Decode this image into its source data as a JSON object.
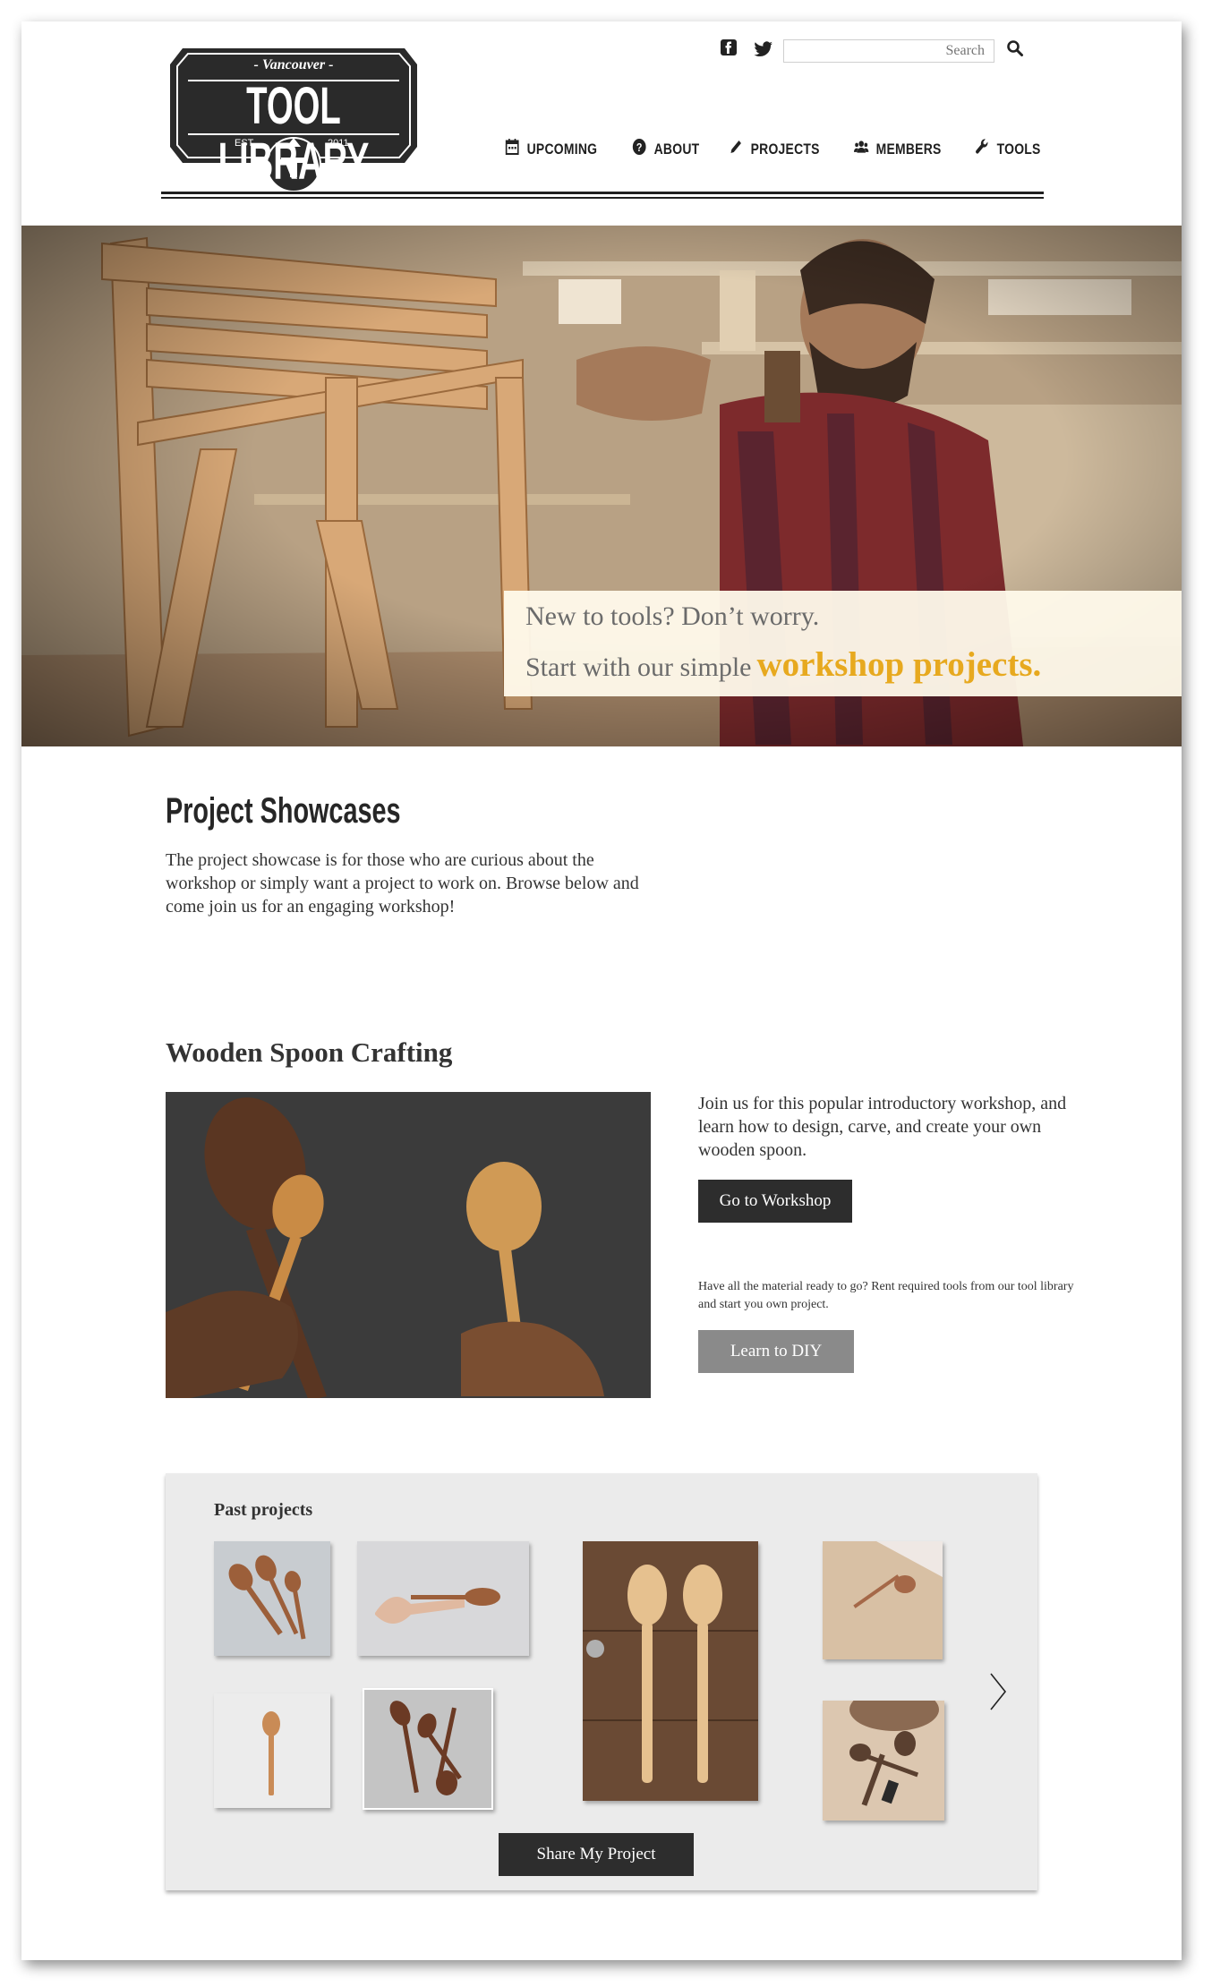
{
  "header": {
    "logo": {
      "top": "- Vancouver -",
      "main": "TOOL LIBRARY",
      "est": "EST.",
      "year": "2011"
    },
    "search_placeholder": "Search",
    "nav": [
      {
        "label": "UPCOMING",
        "icon": "calendar-icon"
      },
      {
        "label": "ABOUT",
        "icon": "question-circle-icon"
      },
      {
        "label": "PROJECTS",
        "icon": "pencil-icon"
      },
      {
        "label": "MEMBERS",
        "icon": "users-icon"
      },
      {
        "label": "TOOLS",
        "icon": "wrench-icon"
      }
    ],
    "social": [
      "facebook-icon",
      "twitter-icon"
    ]
  },
  "hero": {
    "line1": "New to tools? Don’t worry.",
    "line2": "Start with our simple",
    "highlight": "workshop projects.",
    "highlight_color": "#e7a91f"
  },
  "showcase": {
    "title": "Project Showcases",
    "text": "The project showcase is for those who are curious about the workshop or simply want a project to work on. Browse below and come join us for an engaging workshop!"
  },
  "workshop": {
    "title": "Wooden Spoon Crafting",
    "text": "Join us for this popular introductory workshop, and learn how to design, carve, and create your own wooden spoon.",
    "button": "Go to Workshop",
    "diy_text": "Have all the material ready to go? Rent required tools from our tool library and start you own project.",
    "diy_button": "Learn to DIY"
  },
  "past_projects": {
    "title": "Past projects",
    "share_button": "Share My Project"
  }
}
